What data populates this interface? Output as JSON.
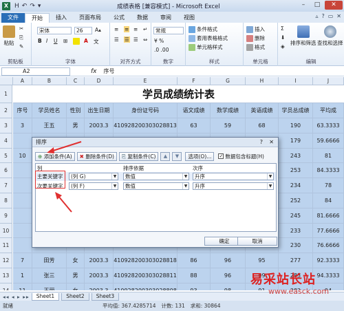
{
  "titlebar": {
    "title": "成绩表格 [兼容模式] - Microsoft Excel",
    "app_icon": "X",
    "qat": [
      "H",
      "↶",
      "↷",
      "▾"
    ],
    "min": "–",
    "max": "□",
    "close": "✕"
  },
  "tabs": [
    "文件",
    "开始",
    "插入",
    "页面布局",
    "公式",
    "数据",
    "审阅",
    "视图"
  ],
  "ribbon": {
    "paste": "粘贴",
    "font_name": "宋体",
    "font_size": "26",
    "bold": "B",
    "italic": "I",
    "underline": "U",
    "wen": "文",
    "number_format": "常规",
    "cond_format": "条件格式",
    "table_format": "套用表格格式",
    "cell_style": "单元格样式",
    "insert": "插入",
    "delete": "删除",
    "format": "格式",
    "sort_filter": "排序和筛选",
    "find_select": "查找和选择",
    "groups": {
      "clipboard": "剪贴板",
      "font": "字体",
      "align": "对齐方式",
      "number": "数字",
      "style": "样式",
      "cells": "单元格",
      "edit": "编辑"
    }
  },
  "formula_bar": {
    "name_box": "A2",
    "fx": "fx",
    "content": "序号"
  },
  "grid": {
    "columns": [
      "A",
      "B",
      "C",
      "D",
      "E",
      "F",
      "G",
      "H",
      "I",
      "J"
    ],
    "title": "学员成绩统计表",
    "header": [
      "序号",
      "学员姓名",
      "性别",
      "出生日期",
      "身份证号码",
      "语文成绩",
      "数学成绩",
      "英语成绩",
      "学员总成绩",
      "平均成"
    ],
    "rows": [
      {
        "n": "3",
        "cells": [
          "3",
          "王五",
          "男",
          "2003.3",
          "410928200303028813",
          "63",
          "59",
          "68",
          "190",
          "63.3333"
        ]
      },
      {
        "n": "4",
        "cells": [
          "",
          "",
          "",
          "",
          "",
          "",
          "",
          "",
          "179",
          "59.6666"
        ]
      },
      {
        "n": "5",
        "cells": [
          "10",
          "",
          "",
          "",
          "",
          "",
          "",
          "",
          "243",
          "81"
        ]
      },
      {
        "n": "6",
        "cells": [
          "",
          "",
          "",
          "",
          "",
          "",
          "",
          "",
          "253",
          "84.3333"
        ]
      },
      {
        "n": "7",
        "cells": [
          "",
          "",
          "",
          "",
          "",
          "",
          "",
          "",
          "234",
          "78"
        ]
      },
      {
        "n": "8",
        "cells": [
          "",
          "",
          "",
          "",
          "",
          "",
          "",
          "",
          "252",
          "84"
        ]
      },
      {
        "n": "9",
        "cells": [
          "",
          "",
          "",
          "",
          "",
          "",
          "",
          "",
          "245",
          "81.6666"
        ]
      },
      {
        "n": "10",
        "cells": [
          "",
          "",
          "",
          "",
          "",
          "",
          "",
          "",
          "233",
          "77.6666"
        ]
      },
      {
        "n": "11",
        "cells": [
          "",
          "",
          "",
          "",
          "",
          "",
          "",
          "",
          "230",
          "76.6666"
        ]
      },
      {
        "n": "12",
        "cells": [
          "7",
          "田芳",
          "女",
          "2003.3",
          "410928200303028818",
          "86",
          "96",
          "95",
          "277",
          "92.3333"
        ]
      },
      {
        "n": "13",
        "cells": [
          "1",
          "张三",
          "男",
          "2003.3",
          "410928200303028811",
          "88",
          "96",
          "99",
          "283",
          "94.3333"
        ]
      },
      {
        "n": "14",
        "cells": [
          "11",
          "王丽",
          "女",
          "2003.3",
          "410928200303028808",
          "93",
          "98",
          "91",
          "282",
          "94"
        ]
      }
    ]
  },
  "sheets": {
    "nav": "◂◂ ◂ ▸ ▸▸",
    "tabs": [
      "Sheet1",
      "Sheet2",
      "Sheet3"
    ]
  },
  "status": {
    "mode": "就绪",
    "average": "平均值: 367.4285714",
    "count": "计数: 131",
    "sum": "求和: 30864"
  },
  "dialog": {
    "title": "排序",
    "help": "?",
    "close": "✕",
    "add_level": "添加条件(A)",
    "delete_level": "删除条件(D)",
    "copy_level": "复制条件(C)",
    "up": "▲",
    "down": "▼",
    "options": "选项(O)...",
    "has_header": "数据包含标题(H)",
    "col_header": "列",
    "sort_on_header": "排序依据",
    "order_header": "次序",
    "levels": [
      {
        "label": "主要关键字",
        "column": "(列 G)",
        "sort_on": "数值",
        "order": "升序"
      },
      {
        "label": "次要关键字",
        "column": "(列 F)",
        "sort_on": "数值",
        "order": "升序"
      }
    ],
    "ok": "确定",
    "cancel": "取消"
  },
  "watermark": {
    "text": "易采站长站",
    "url": "www.easck.com"
  }
}
